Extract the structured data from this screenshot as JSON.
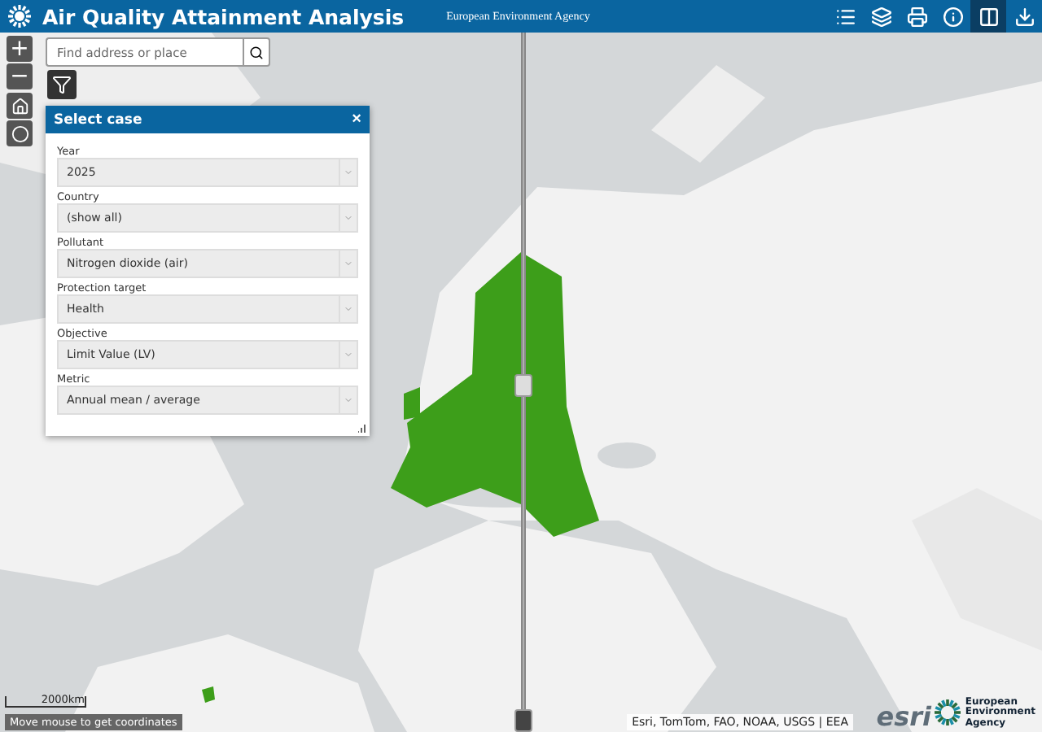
{
  "header": {
    "title": "Air Quality Attainment Analysis",
    "subtitle": "European Environment Agency",
    "tools": [
      {
        "kind": "list",
        "selected": false
      },
      {
        "kind": "layers",
        "selected": false
      },
      {
        "kind": "print",
        "selected": false
      },
      {
        "kind": "info",
        "selected": false
      },
      {
        "kind": "swipe",
        "selected": true
      },
      {
        "kind": "download",
        "selected": false
      }
    ]
  },
  "map": {
    "kind": "picture",
    "zoom_in": "+",
    "zoom_out": "−",
    "search": {
      "placeholder": "Find address or place"
    }
  },
  "panel": {
    "title": "Select case",
    "close": "×",
    "fields": [
      {
        "label": "Year",
        "value": "2025"
      },
      {
        "label": "Country",
        "value": "(show all)"
      },
      {
        "label": "Pollutant",
        "value": "Nitrogen dioxide (air)"
      },
      {
        "label": "Protection target",
        "value": "Health"
      },
      {
        "label": "Objective",
        "value": "Limit Value (LV)"
      },
      {
        "label": "Metric",
        "value": "Annual mean / average"
      }
    ]
  },
  "footer": {
    "scale": "2000km",
    "coordinates": "Move mouse to get coordinates",
    "attribution": "Esri, TomTom, FAO, NOAA, USGS | EEA",
    "esri": "esri",
    "agency": [
      "European",
      "Environment",
      "Agency"
    ]
  }
}
